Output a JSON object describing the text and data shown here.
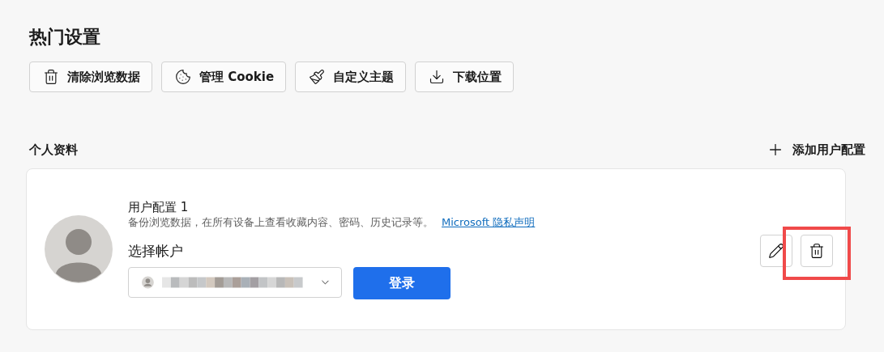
{
  "heading": "热门设置",
  "quick_actions": [
    {
      "kind": "trash",
      "label": "清除浏览数据"
    },
    {
      "kind": "cookie",
      "label": "管理 Cookie"
    },
    {
      "kind": "brush",
      "label": "自定义主题"
    },
    {
      "kind": "download",
      "label": "下载位置"
    }
  ],
  "profiles": {
    "title": "个人资料",
    "add_button": "添加用户配置",
    "card": {
      "name": "用户配置 1",
      "description": "备份浏览数据，在所有设备上查看收藏内容、密码、历史记录等。",
      "link": "Microsoft 隐私声明",
      "account_label": "选择帐户",
      "sign_in_button": "登录",
      "actions": [
        {
          "kind": "edit",
          "highlighted": false
        },
        {
          "kind": "delete",
          "highlighted": true
        }
      ]
    }
  }
}
